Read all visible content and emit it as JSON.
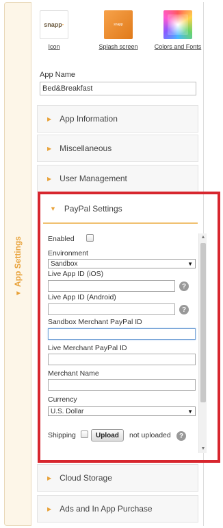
{
  "side_tab": {
    "label": "App Settings"
  },
  "assets": [
    {
      "caption": "Icon",
      "thumb_text": "snapp"
    },
    {
      "caption": "Splash screen",
      "thumb_text": "snapp"
    },
    {
      "caption": "Colors and Fonts"
    }
  ],
  "app_name": {
    "label": "App Name",
    "value": "Bed&Breakfast"
  },
  "sections_top": [
    {
      "label": "App Information"
    },
    {
      "label": "Miscellaneous"
    },
    {
      "label": "User Management"
    }
  ],
  "paypal": {
    "title": "PayPal Settings",
    "enabled_label": "Enabled",
    "environment_label": "Environment",
    "environment_value": "Sandbox",
    "live_ios_label": "Live App ID (iOS)",
    "live_ios_value": "",
    "live_android_label": "Live App ID (Android)",
    "live_android_value": "",
    "sandbox_merchant_label": "Sandbox Merchant PayPal ID",
    "sandbox_merchant_value": "",
    "live_merchant_label": "Live Merchant PayPal ID",
    "live_merchant_value": "",
    "merchant_name_label": "Merchant Name",
    "merchant_name_value": "",
    "currency_label": "Currency",
    "currency_value": "U.S. Dollar",
    "shipping_label": "Shipping",
    "upload_label": "Upload",
    "upload_status": "not uploaded",
    "help_glyph": "?"
  },
  "sections_bottom": [
    {
      "label": "Cloud Storage"
    },
    {
      "label": "Ads and In App Purchase"
    }
  ],
  "icons": {
    "chevron_right": "▶",
    "chevron_down": "▼",
    "dropdown_arrow": "▼",
    "scroll_up": "▲",
    "scroll_down": "▼"
  },
  "colors": {
    "accent": "#e8a23a",
    "highlight_border": "#d7262e",
    "side_tab_bg": "#fdf6e8"
  }
}
